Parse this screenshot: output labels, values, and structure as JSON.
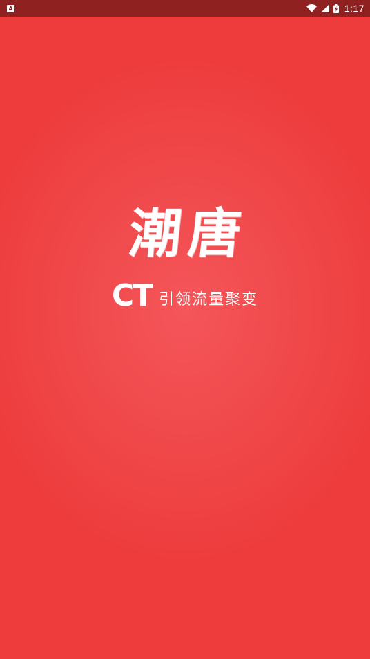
{
  "status_bar": {
    "notification_icon": "A",
    "time": "1:17",
    "icons": [
      "wifi-icon",
      "cell-signal-icon",
      "battery-charging-icon"
    ]
  },
  "splash": {
    "title": "潮唐",
    "logo_text": "CT",
    "slogan": "引领流量聚变"
  },
  "colors": {
    "background": "#ee3b3b",
    "status_bar": "#8f2121",
    "text": "#ffffff"
  }
}
